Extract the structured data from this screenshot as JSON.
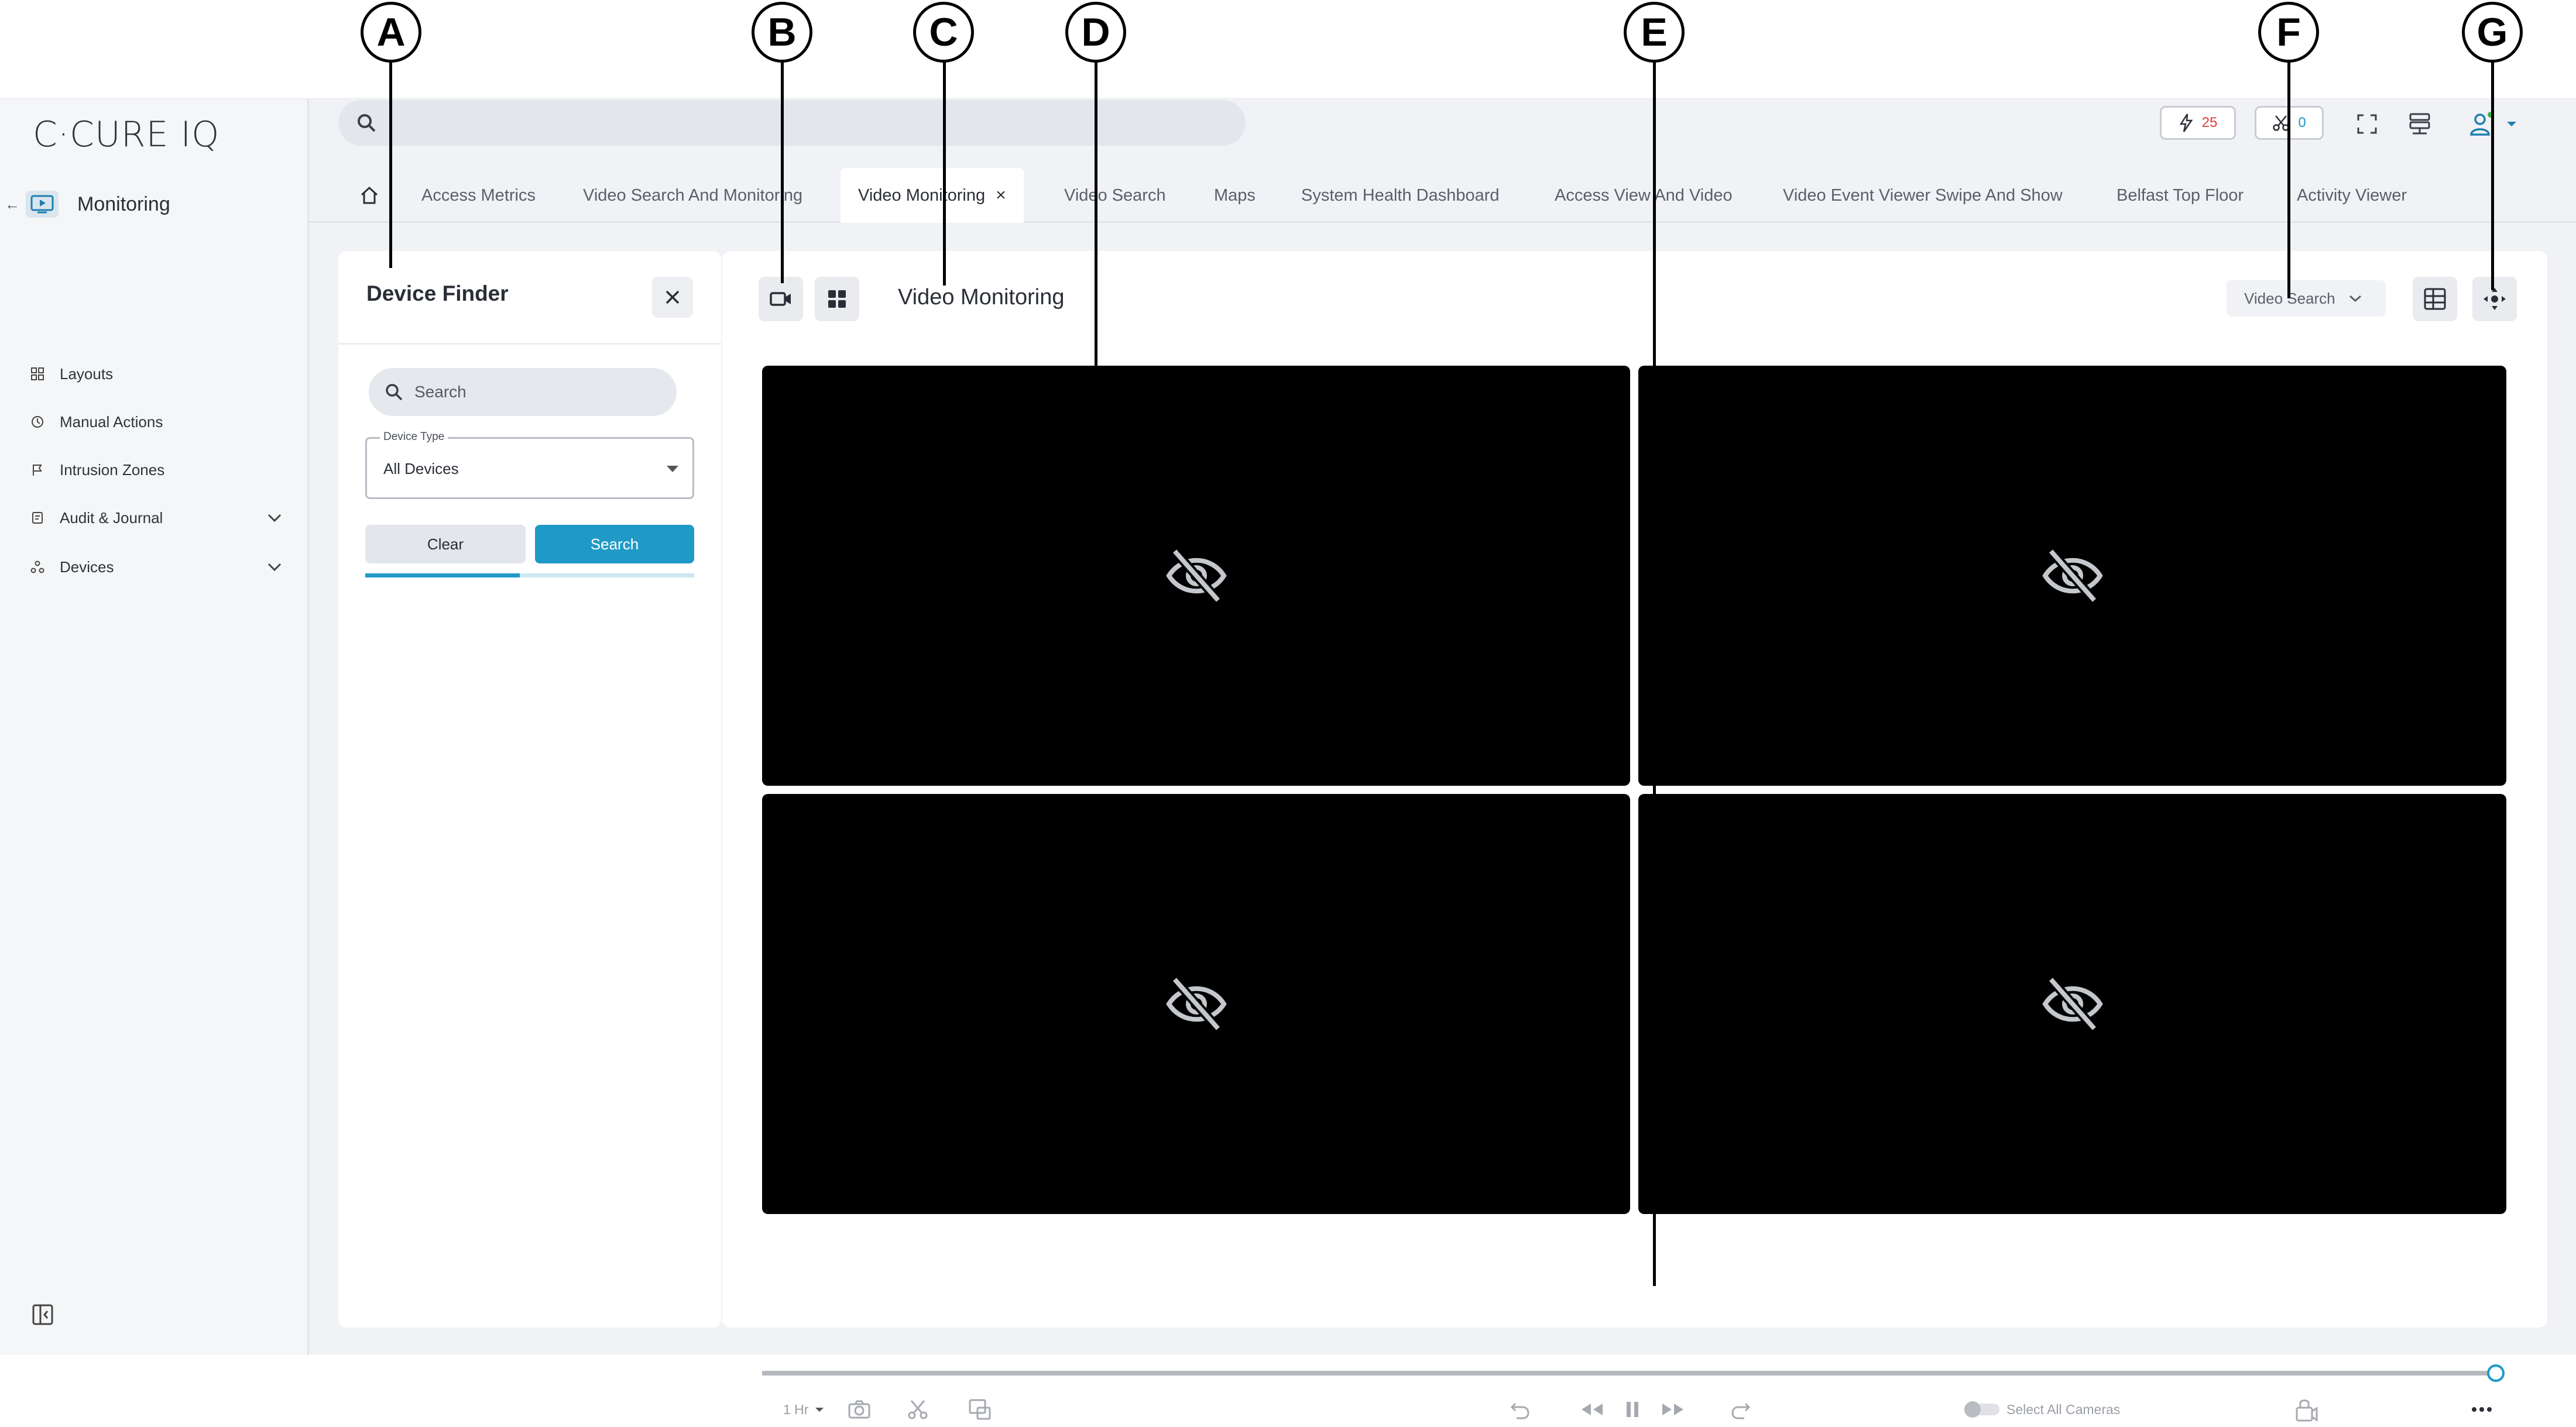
{
  "callouts": [
    "A",
    "B",
    "C",
    "D",
    "E",
    "F",
    "G"
  ],
  "app": {
    "logo": "C·CURE IQ",
    "search_placeholder": ""
  },
  "sidebar": {
    "main_label": "Monitoring",
    "items": [
      {
        "label": "Layouts",
        "icon": "layouts-icon"
      },
      {
        "label": "Manual Actions",
        "icon": "manual-actions-icon"
      },
      {
        "label": "Intrusion Zones",
        "icon": "flag-icon"
      },
      {
        "label": "Audit & Journal",
        "icon": "journal-icon",
        "expandable": true
      },
      {
        "label": "Devices",
        "icon": "devices-icon",
        "expandable": true
      }
    ]
  },
  "topbar": {
    "events_count": "25",
    "cut_count": "0",
    "events_color": "#e23a3a",
    "cut_color": "#1f9ac7"
  },
  "tabs": [
    "Access Metrics",
    "Video Search And Monitoring",
    "Video Monitoring",
    "Video Search",
    "Maps",
    "System Health Dashboard",
    "Access View And Video",
    "Video Event Viewer Swipe And Show",
    "Belfast Top Floor",
    "Activity Viewer"
  ],
  "active_tab": "Video Monitoring",
  "device_finder": {
    "title": "Device Finder",
    "search_placeholder": "Search",
    "device_type_label": "Device Type",
    "device_type_value": "All Devices",
    "clear_label": "Clear",
    "search_label": "Search",
    "progress": 0.47,
    "accent": "#1f9ac7"
  },
  "video_panel": {
    "title": "Video Monitoring",
    "mode_dropdown": "Video Search",
    "tiles": [
      {
        "state": "no-video"
      },
      {
        "state": "no-video"
      },
      {
        "state": "no-video"
      },
      {
        "state": "no-video"
      }
    ],
    "controls": {
      "duration": "1 Hr",
      "select_all": "Select All Cameras"
    }
  }
}
